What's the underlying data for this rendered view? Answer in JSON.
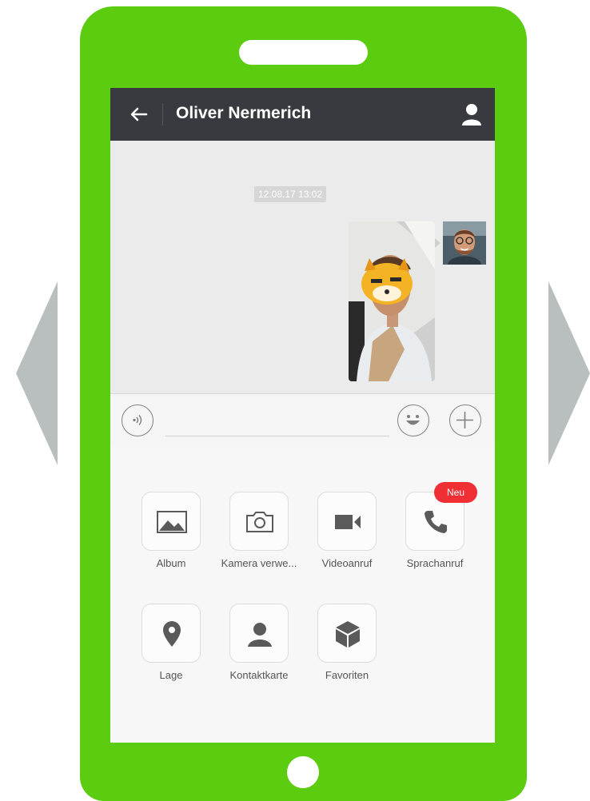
{
  "window": {
    "title": "Oliver Nermerich"
  },
  "chat": {
    "timestamp": "12.08.17 13:02"
  },
  "panel": {
    "items": [
      {
        "label": "Album",
        "icon": "image-icon"
      },
      {
        "label": "Kamera verwe...",
        "icon": "camera-icon"
      },
      {
        "label": "Videoanruf",
        "icon": "video-icon"
      },
      {
        "label": "Sprachanruf",
        "icon": "phone-icon",
        "badge": "Neu"
      },
      {
        "label": "Lage",
        "icon": "location-icon"
      },
      {
        "label": "Kontaktkarte",
        "icon": "contact-card-icon"
      },
      {
        "label": "Favoriten",
        "icon": "cube-icon"
      }
    ]
  },
  "colors": {
    "phone_body": "#5ccc10",
    "topbar": "#393a3f",
    "badge": "#ef2f34",
    "arrows": "#b9bebe"
  }
}
